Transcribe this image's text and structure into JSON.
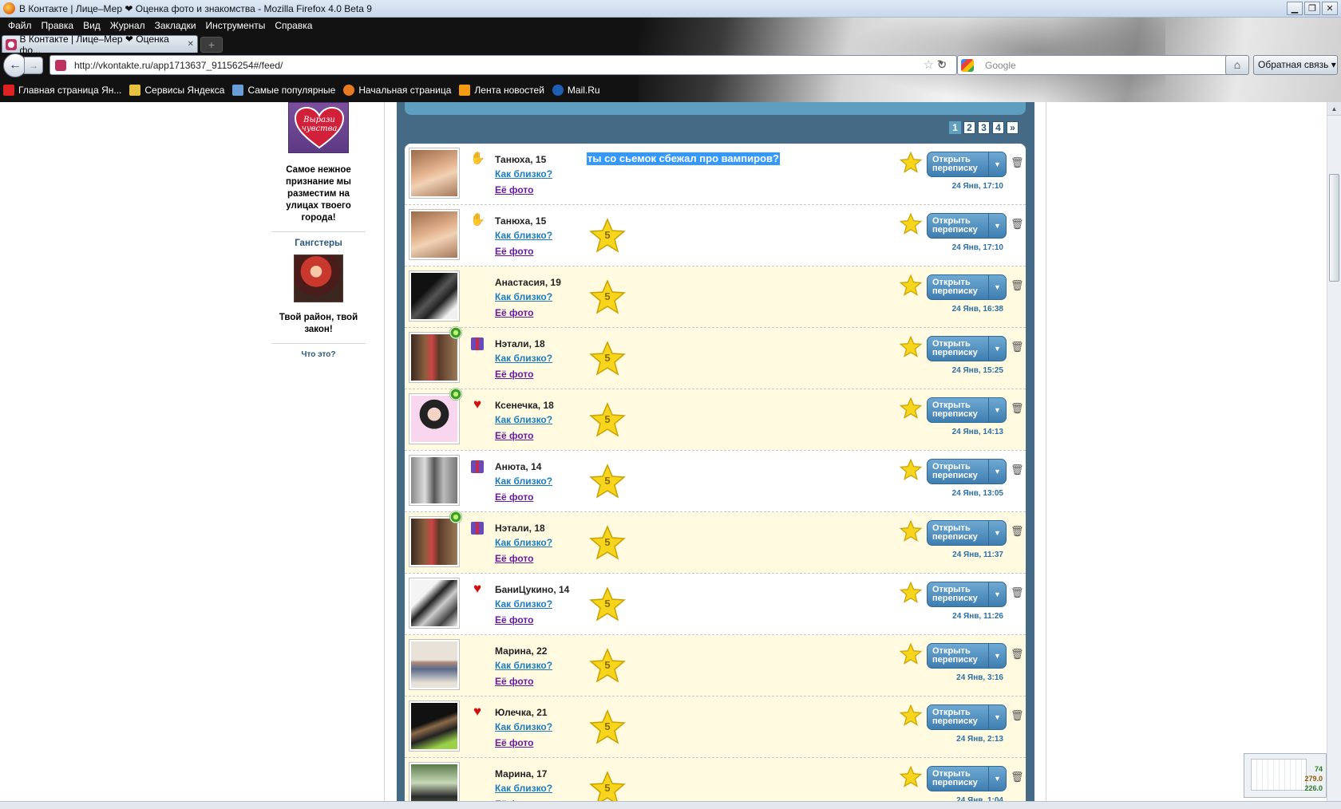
{
  "window": {
    "title": "В Контакте | Лице–Мер ❤ Оценка фото и знакомства - Mozilla Firefox 4.0 Beta 9"
  },
  "menu": [
    "Файл",
    "Правка",
    "Вид",
    "Журнал",
    "Закладки",
    "Инструменты",
    "Справка"
  ],
  "tab": {
    "label": "В Контакте | Лице–Мер ❤ Оценка фо..."
  },
  "nav": {
    "url": "http://vkontakte.ru/app1713637_91156254#/feed/",
    "search_placeholder": "Google",
    "feedback_label": "Обратная связь"
  },
  "bookmarks": [
    {
      "label": "Главная страница Ян...",
      "icon": "yandex-icon",
      "color": "#d22"
    },
    {
      "label": "Сервисы Яндекса",
      "icon": "folder-icon",
      "color": "#e8c040"
    },
    {
      "label": "Самые популярные",
      "icon": "popular-icon",
      "color": "#6a9ed8"
    },
    {
      "label": "Начальная страница",
      "icon": "firefox-icon",
      "color": "#e87a20"
    },
    {
      "label": "Лента новостей",
      "icon": "rss-icon",
      "color": "#f39c12"
    },
    {
      "label": "Mail.Ru",
      "icon": "mailru-icon",
      "color": "#1e5fb4"
    }
  ],
  "sidebar": {
    "ad1": {
      "image_text": "Вырази чувства",
      "text": "Самое нежное признание мы разместим на улицах твоего города!"
    },
    "ad2": {
      "title": "Гангстеры",
      "text": "Твой район, твой закон!"
    },
    "what_link": "Что это?"
  },
  "pager": {
    "pages": [
      "1",
      "2",
      "3",
      "4",
      "»"
    ],
    "current": "1"
  },
  "feed": {
    "open_label_1": "Открыть",
    "open_label_2": "переписку",
    "link_close": "Как близко?",
    "link_photo": "Её фото",
    "items": [
      {
        "name": "Танюха, 15",
        "badge": "wave",
        "message": "ты со сьемок сбежал про вампиров?",
        "rating": "",
        "date": "24 Янв, 17:10",
        "online": false,
        "alt": false,
        "photo": "linear-gradient(160deg,#9b6a4a,#e3b48f 45%,#f1d2b5 60%,#a4775a)"
      },
      {
        "name": "Танюха, 15",
        "badge": "wave",
        "message": "",
        "rating": "5",
        "date": "24 Янв, 17:10",
        "online": false,
        "alt": false,
        "photo": "linear-gradient(160deg,#9b6a4a,#e3b48f 45%,#f1d2b5 60%,#a4775a)"
      },
      {
        "name": "Анастасия, 19",
        "badge": "",
        "message": "",
        "rating": "5",
        "date": "24 Янв, 16:38",
        "online": false,
        "alt": true,
        "photo": "linear-gradient(135deg,#111 0 35%,#555 50%,#222 65%,#f0f0f0 85%)"
      },
      {
        "name": "Нэтали, 18",
        "badge": "gift",
        "message": "",
        "rating": "5",
        "date": "24 Янв, 15:25",
        "online": true,
        "alt": true,
        "photo": "linear-gradient(90deg,#3a2a20,#8a6040 30%,#c44 45%,#5a3a28 60%,#9a7a58)"
      },
      {
        "name": "Ксенечка, 18",
        "badge": "heart",
        "message": "",
        "rating": "5",
        "date": "24 Янв, 14:13",
        "online": true,
        "alt": true,
        "photo": "radial-gradient(circle at 50% 40%,#f3d4c4 0 18%,#222 19% 40%,#f7d6ee 41%)"
      },
      {
        "name": "Анюта, 14",
        "badge": "gift",
        "message": "",
        "rating": "5",
        "date": "24 Янв, 13:05",
        "online": false,
        "alt": false,
        "photo": "linear-gradient(90deg,#888,#ddd 30%,#555 50%,#bbb 70%,#777)"
      },
      {
        "name": "Нэтали, 18",
        "badge": "gift",
        "message": "",
        "rating": "5",
        "date": "24 Янв, 11:37",
        "online": true,
        "alt": true,
        "photo": "linear-gradient(90deg,#3a2a20,#8a6040 30%,#c44 45%,#5a3a28 60%,#9a7a58)"
      },
      {
        "name": "БаниЦукино, 14",
        "badge": "heart",
        "message": "",
        "rating": "5",
        "date": "24 Янв, 11:26",
        "online": false,
        "alt": false,
        "photo": "linear-gradient(135deg,#f4f4f4 0 30%,#222 45%,#ccc 60%,#444 80%,#eee)"
      },
      {
        "name": "Марина, 22",
        "badge": "",
        "message": "",
        "rating": "5",
        "date": "24 Янв, 3:16",
        "online": false,
        "alt": true,
        "photo": "linear-gradient(180deg,#e8e2d8 0 40%,#b08a7a 45%,#5a6a8a 60%,#e8e2d8 90%)"
      },
      {
        "name": "Юлечка, 21",
        "badge": "heart",
        "message": "",
        "rating": "5",
        "date": "24 Янв, 2:13",
        "online": false,
        "alt": true,
        "photo": "linear-gradient(160deg,#111 0 40%,#8a6a4a 50%,#222 65%,#9ad04a 85%)"
      },
      {
        "name": "Марина, 17",
        "badge": "",
        "message": "",
        "rating": "5",
        "date": "24 Янв, 1:04",
        "online": false,
        "alt": true,
        "photo": "linear-gradient(180deg,#5a7a4a,#c8d8b8 40%,#2a2a2a 70%,#6a8a5a)"
      }
    ]
  },
  "widget": {
    "v1": "74",
    "v2": "279.0",
    "v3": "226.0"
  },
  "colors": {
    "accent": "#2b587a",
    "main_bg": "#456a85",
    "highlight": "#fffae0",
    "button": "#4a8abd"
  }
}
